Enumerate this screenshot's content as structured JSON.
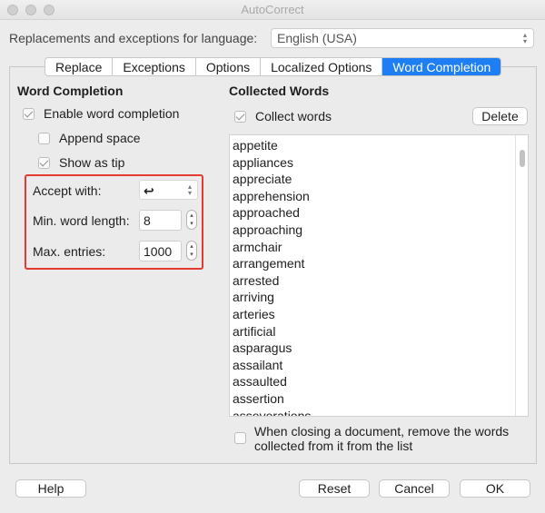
{
  "window": {
    "title": "AutoCorrect"
  },
  "language": {
    "label": "Replacements and exceptions for language:",
    "value": "English (USA)"
  },
  "tabs": [
    {
      "label": "Replace",
      "active": false
    },
    {
      "label": "Exceptions",
      "active": false
    },
    {
      "label": "Options",
      "active": false
    },
    {
      "label": "Localized Options",
      "active": false
    },
    {
      "label": "Word Completion",
      "active": true
    }
  ],
  "word_completion": {
    "heading": "Word Completion",
    "enable_label": "Enable word completion",
    "enable_checked": true,
    "append_label": "Append space",
    "append_checked": false,
    "tip_label": "Show as tip",
    "tip_checked": true,
    "accept_label": "Accept with:",
    "accept_value": "↩",
    "min_length_label": "Min. word length:",
    "min_length_value": "8",
    "max_entries_label": "Max. entries:",
    "max_entries_value": "1000"
  },
  "collected": {
    "heading": "Collected Words",
    "collect_label": "Collect words",
    "collect_checked": true,
    "delete_label": "Delete",
    "words": [
      "appetite",
      "appliances",
      "appreciate",
      "apprehension",
      "approached",
      "approaching",
      "armchair",
      "arrangement",
      "arrested",
      "arriving",
      "arteries",
      "artificial",
      "asparagus",
      "assailant",
      "assaulted",
      "assertion",
      "asseverations"
    ],
    "remove_line1": "When closing a document, remove the words",
    "remove_line2": "collected from it from the list",
    "remove_checked": false
  },
  "footer": {
    "help": "Help",
    "reset": "Reset",
    "cancel": "Cancel",
    "ok": "OK"
  },
  "colors": {
    "accent": "#1e7ff5",
    "highlight": "#e53a32"
  }
}
